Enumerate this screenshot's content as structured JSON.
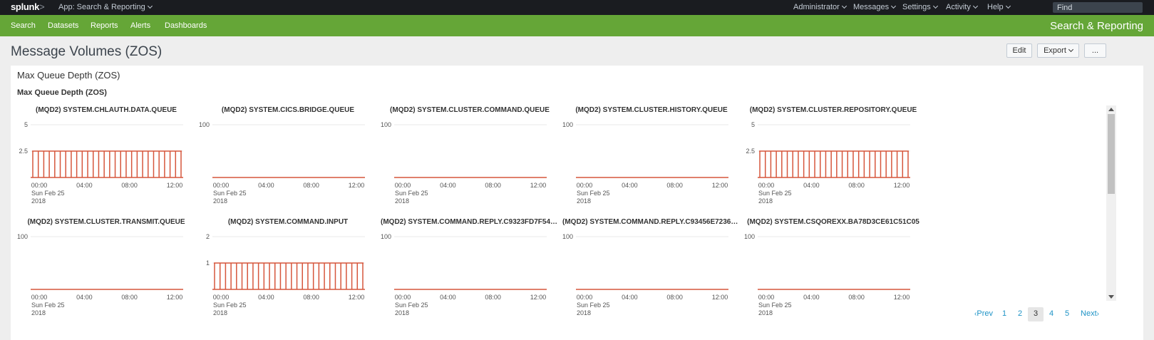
{
  "topbar": {
    "logo": "splunk",
    "logo_suffix": ">",
    "app_menu": "App: Search & Reporting",
    "menus": [
      "Administrator",
      "Messages",
      "Settings",
      "Activity",
      "Help"
    ],
    "find_placeholder": "Find"
  },
  "nav": {
    "items": [
      "Search",
      "Datasets",
      "Reports",
      "Alerts",
      "Dashboards"
    ],
    "app_title": "Search & Reporting"
  },
  "page": {
    "title": "Message Volumes (ZOS)",
    "buttons": {
      "edit": "Edit",
      "export": "Export",
      "more": "..."
    }
  },
  "panel": {
    "title": "Max Queue Depth (ZOS)",
    "viz_title": "Max Queue Depth (ZOS)"
  },
  "colors": {
    "series": "#d6563c",
    "nav_green": "#65a637",
    "topbar": "#1a1c20"
  },
  "x_ticks": [
    "00:00",
    "04:00",
    "08:00",
    "12:00"
  ],
  "x_sub": [
    "Sun Feb 25",
    "2018"
  ],
  "charts": [
    {
      "title": "(MQD2) SYSTEM.CHLAUTH.DATA.QUEUE",
      "y_ticks": [
        "5",
        "2.5"
      ],
      "y_max": 5,
      "pattern": "spikes",
      "level": 2.5
    },
    {
      "title": "(MQD2) SYSTEM.CICS.BRIDGE.QUEUE",
      "y_ticks": [
        "100"
      ],
      "y_max": 100,
      "pattern": "flat",
      "level": 0
    },
    {
      "title": "(MQD2) SYSTEM.CLUSTER.COMMAND.QUEUE",
      "y_ticks": [
        "100"
      ],
      "y_max": 100,
      "pattern": "flat",
      "level": 0
    },
    {
      "title": "(MQD2) SYSTEM.CLUSTER.HISTORY.QUEUE",
      "y_ticks": [
        "100"
      ],
      "y_max": 100,
      "pattern": "flat",
      "level": 0
    },
    {
      "title": "(MQD2) SYSTEM.CLUSTER.REPOSITORY.QUEUE",
      "y_ticks": [
        "5",
        "2.5"
      ],
      "y_max": 5,
      "pattern": "spikes",
      "level": 2.5
    },
    {
      "title": "(MQD2) SYSTEM.CLUSTER.TRANSMIT.QUEUE",
      "y_ticks": [
        "100"
      ],
      "y_max": 100,
      "pattern": "flat",
      "level": 0
    },
    {
      "title": "(MQD2) SYSTEM.COMMAND.INPUT",
      "y_ticks": [
        "2",
        "1"
      ],
      "y_max": 2,
      "pattern": "spikes",
      "level": 1
    },
    {
      "title": "(MQD2) SYSTEM.COMMAND.REPLY.C9323FD7F54B2...",
      "y_ticks": [
        "100"
      ],
      "y_max": 100,
      "pattern": "flat",
      "level": 0
    },
    {
      "title": "(MQD2) SYSTEM.COMMAND.REPLY.C93456E7236AB...",
      "y_ticks": [
        "100"
      ],
      "y_max": 100,
      "pattern": "flat",
      "level": 0
    },
    {
      "title": "(MQD2) SYSTEM.CSQOREXX.BA78D3CE61C51C05",
      "y_ticks": [
        "100"
      ],
      "y_max": 100,
      "pattern": "flat",
      "level": 0
    }
  ],
  "pager": {
    "prev": "Prev",
    "pages": [
      "1",
      "2",
      "3",
      "4",
      "5"
    ],
    "active": "3",
    "next": "Next"
  }
}
